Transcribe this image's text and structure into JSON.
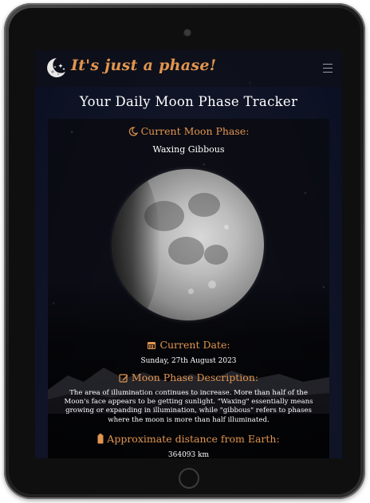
{
  "brand": {
    "name": "It's just a phase!",
    "logo_icon": "crescent-moon-stars-icon",
    "accent_color": "#e2954f"
  },
  "nav": {
    "menu_icon": "hamburger-menu-icon"
  },
  "page": {
    "title": "Your Daily Moon Phase Tracker"
  },
  "current_phase": {
    "heading_icon": "crescent-moon-icon",
    "heading": "Current Moon Phase:",
    "value": "Waxing Gibbous",
    "image": "waxing-gibbous-moon-image"
  },
  "current_date": {
    "heading_icon": "calendar-icon",
    "heading": "Current Date:",
    "value": "Sunday, 27th August 2023"
  },
  "description": {
    "heading_icon": "edit-note-icon",
    "heading": "Moon Phase Description:",
    "text": "The area of illumination continues to increase. More than half of the Moon's face appears to be getting sunlight. \"Waxing\" essentially means growing or expanding in illumination, while \"gibbous\" refers to phases where the moon is more than half illuminated."
  },
  "distance": {
    "heading_icon": "battery-icon",
    "heading": "Approximate distance from Earth:",
    "value": "364093 km"
  }
}
